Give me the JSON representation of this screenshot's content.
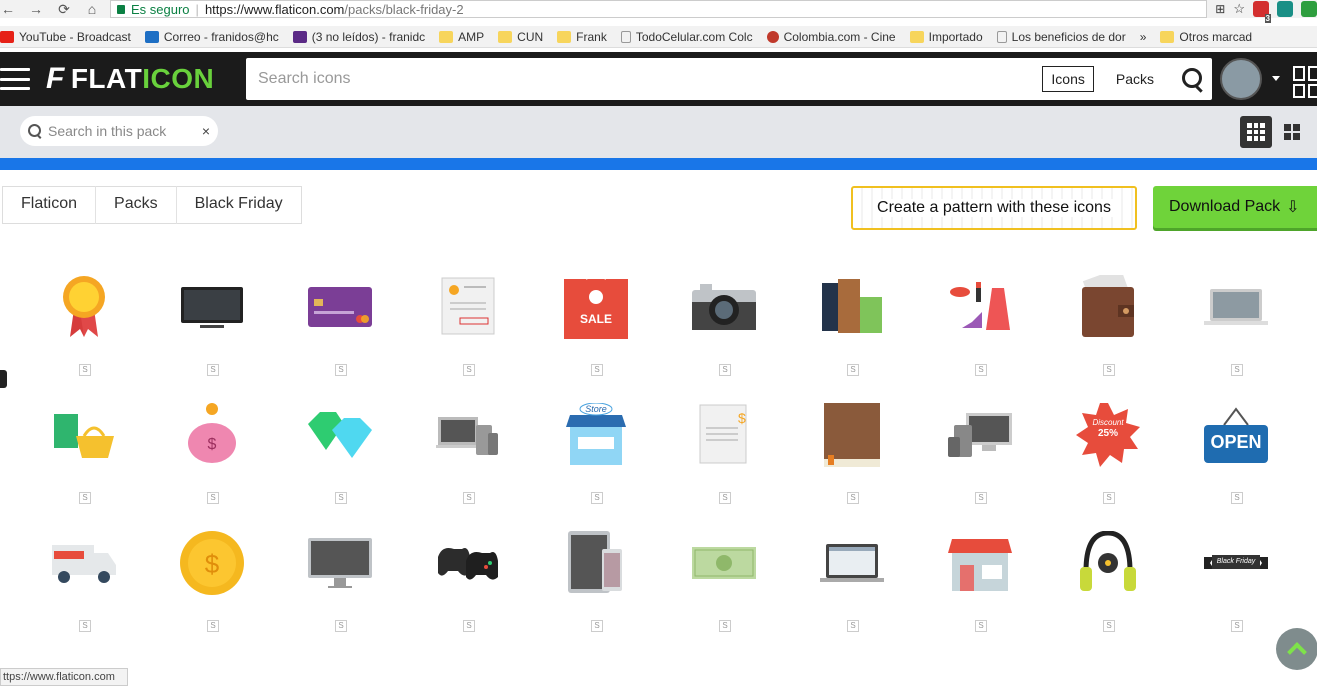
{
  "browser": {
    "secure_label": "Es seguro",
    "url_base": "https://www.flaticon.com",
    "url_path": "/packs/black-friday-2",
    "ext_badge": "3"
  },
  "bookmarks": [
    {
      "label": "YouTube - Broadcast",
      "color": "#e62117"
    },
    {
      "label": "Correo - franidos@hc",
      "color": "#1e6fc4"
    },
    {
      "label": "(3 no leídos) - franidc",
      "color": "#5b2a86"
    },
    {
      "label": "AMP",
      "color": "#f7d55c"
    },
    {
      "label": "CUN",
      "color": "#f7d55c"
    },
    {
      "label": "Frank",
      "color": "#f7d55c"
    },
    {
      "label": "TodoCelular.com Colc",
      "color": "#ffffff"
    },
    {
      "label": "Colombia.com - Cine",
      "color": "#c0392b"
    },
    {
      "label": "Importado",
      "color": "#f7d55c"
    },
    {
      "label": "Los beneficios de dor",
      "color": "#ffffff"
    }
  ],
  "bookmarks_more": "»",
  "bookmarks_other": "Otros marcad",
  "header": {
    "logo_text_a": "FLAT",
    "logo_text_b": "ICON",
    "search_placeholder": "Search icons",
    "tab_icons": "Icons",
    "tab_packs": "Packs"
  },
  "subbar": {
    "pack_search_placeholder": "Search in this pack",
    "clear": "×"
  },
  "breadcrumb": [
    "Flaticon",
    "Packs",
    "Black Friday"
  ],
  "pattern_button": "Create a pattern with these icons",
  "download_button": "Download Pack",
  "premium_badge": "S",
  "icons": [
    [
      "medal-icon",
      "tv-icon",
      "credit-card-icon",
      "certificate-icon",
      "shopping-bag-sale-icon",
      "camera-icon",
      "clothes-icon",
      "fashion-icon",
      "wallet-icon",
      "laptop-icon"
    ],
    [
      "basket-bag-icon",
      "piggy-bank-icon",
      "diamonds-icon",
      "devices-icon",
      "store-icon",
      "receipt-icon",
      "book-icon",
      "computer-devices-icon",
      "discount-badge-icon",
      "open-sign-icon"
    ],
    [
      "delivery-truck-icon",
      "coin-icon",
      "monitor-icon",
      "gamepad-icon",
      "tablet-phone-icon",
      "banknote-icon",
      "laptop-browser-icon",
      "shop-icon",
      "headphones-icon",
      "black-friday-ribbon-icon"
    ]
  ],
  "icon_text": {
    "sale": "SALE",
    "open": "OPEN",
    "discount": "Discount",
    "discount_value": "25%",
    "store": "Store",
    "ribbon": "Black Friday"
  },
  "status_url": "ttps://www.flaticon.com"
}
